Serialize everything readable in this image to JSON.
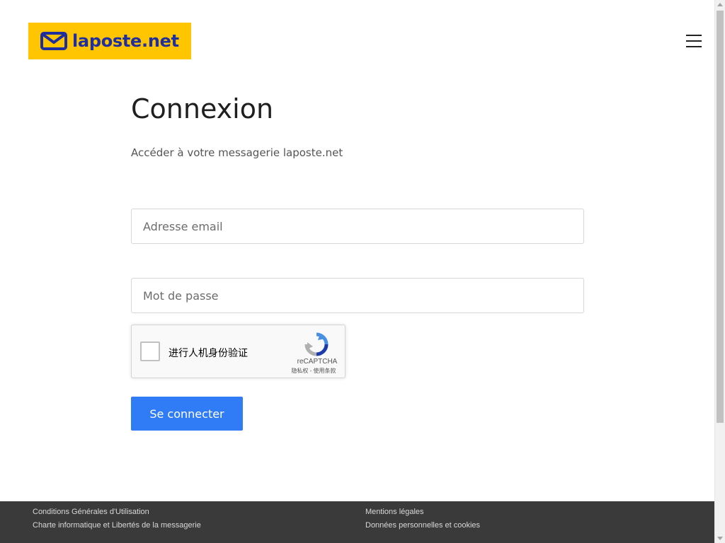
{
  "header": {
    "logo_text": "laposte.net",
    "brand_color": "#ffc600",
    "logo_text_color": "#1f2fa0",
    "menu_icon": "hamburger-icon"
  },
  "main": {
    "title": "Connexion",
    "subtitle": "Accéder à votre messagerie laposte.net",
    "email_placeholder": "Adresse email",
    "email_value": "",
    "password_placeholder": "Mot de passe",
    "password_value": "",
    "submit_label": "Se connecter",
    "submit_color": "#2f7cf6"
  },
  "recaptcha": {
    "label": "进行人机身份验证",
    "brand": "reCAPTCHA",
    "links": "隐私权 - 使用条款",
    "checked": false
  },
  "footer": {
    "background": "#3a3a3a",
    "links": [
      "Conditions Générales d'Utilisation",
      "Charte informatique et Libertés de la messagerie",
      "Mentions légales",
      "Données personnelles et cookies"
    ]
  }
}
